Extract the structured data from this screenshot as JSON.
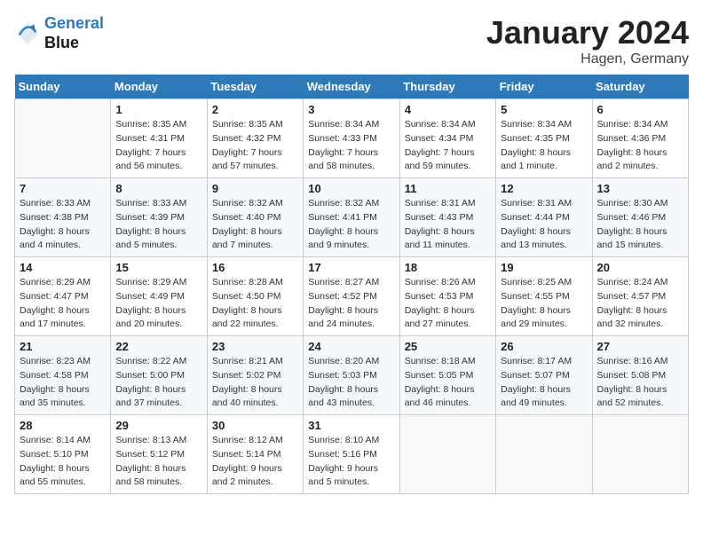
{
  "logo": {
    "line1": "General",
    "line2": "Blue"
  },
  "title": "January 2024",
  "subtitle": "Hagen, Germany",
  "days_of_week": [
    "Sunday",
    "Monday",
    "Tuesday",
    "Wednesday",
    "Thursday",
    "Friday",
    "Saturday"
  ],
  "weeks": [
    [
      {
        "day": "",
        "info": ""
      },
      {
        "day": "1",
        "info": "Sunrise: 8:35 AM\nSunset: 4:31 PM\nDaylight: 7 hours\nand 56 minutes."
      },
      {
        "day": "2",
        "info": "Sunrise: 8:35 AM\nSunset: 4:32 PM\nDaylight: 7 hours\nand 57 minutes."
      },
      {
        "day": "3",
        "info": "Sunrise: 8:34 AM\nSunset: 4:33 PM\nDaylight: 7 hours\nand 58 minutes."
      },
      {
        "day": "4",
        "info": "Sunrise: 8:34 AM\nSunset: 4:34 PM\nDaylight: 7 hours\nand 59 minutes."
      },
      {
        "day": "5",
        "info": "Sunrise: 8:34 AM\nSunset: 4:35 PM\nDaylight: 8 hours\nand 1 minute."
      },
      {
        "day": "6",
        "info": "Sunrise: 8:34 AM\nSunset: 4:36 PM\nDaylight: 8 hours\nand 2 minutes."
      }
    ],
    [
      {
        "day": "7",
        "info": "Sunrise: 8:33 AM\nSunset: 4:38 PM\nDaylight: 8 hours\nand 4 minutes."
      },
      {
        "day": "8",
        "info": "Sunrise: 8:33 AM\nSunset: 4:39 PM\nDaylight: 8 hours\nand 5 minutes."
      },
      {
        "day": "9",
        "info": "Sunrise: 8:32 AM\nSunset: 4:40 PM\nDaylight: 8 hours\nand 7 minutes."
      },
      {
        "day": "10",
        "info": "Sunrise: 8:32 AM\nSunset: 4:41 PM\nDaylight: 8 hours\nand 9 minutes."
      },
      {
        "day": "11",
        "info": "Sunrise: 8:31 AM\nSunset: 4:43 PM\nDaylight: 8 hours\nand 11 minutes."
      },
      {
        "day": "12",
        "info": "Sunrise: 8:31 AM\nSunset: 4:44 PM\nDaylight: 8 hours\nand 13 minutes."
      },
      {
        "day": "13",
        "info": "Sunrise: 8:30 AM\nSunset: 4:46 PM\nDaylight: 8 hours\nand 15 minutes."
      }
    ],
    [
      {
        "day": "14",
        "info": "Sunrise: 8:29 AM\nSunset: 4:47 PM\nDaylight: 8 hours\nand 17 minutes."
      },
      {
        "day": "15",
        "info": "Sunrise: 8:29 AM\nSunset: 4:49 PM\nDaylight: 8 hours\nand 20 minutes."
      },
      {
        "day": "16",
        "info": "Sunrise: 8:28 AM\nSunset: 4:50 PM\nDaylight: 8 hours\nand 22 minutes."
      },
      {
        "day": "17",
        "info": "Sunrise: 8:27 AM\nSunset: 4:52 PM\nDaylight: 8 hours\nand 24 minutes."
      },
      {
        "day": "18",
        "info": "Sunrise: 8:26 AM\nSunset: 4:53 PM\nDaylight: 8 hours\nand 27 minutes."
      },
      {
        "day": "19",
        "info": "Sunrise: 8:25 AM\nSunset: 4:55 PM\nDaylight: 8 hours\nand 29 minutes."
      },
      {
        "day": "20",
        "info": "Sunrise: 8:24 AM\nSunset: 4:57 PM\nDaylight: 8 hours\nand 32 minutes."
      }
    ],
    [
      {
        "day": "21",
        "info": "Sunrise: 8:23 AM\nSunset: 4:58 PM\nDaylight: 8 hours\nand 35 minutes."
      },
      {
        "day": "22",
        "info": "Sunrise: 8:22 AM\nSunset: 5:00 PM\nDaylight: 8 hours\nand 37 minutes."
      },
      {
        "day": "23",
        "info": "Sunrise: 8:21 AM\nSunset: 5:02 PM\nDaylight: 8 hours\nand 40 minutes."
      },
      {
        "day": "24",
        "info": "Sunrise: 8:20 AM\nSunset: 5:03 PM\nDaylight: 8 hours\nand 43 minutes."
      },
      {
        "day": "25",
        "info": "Sunrise: 8:18 AM\nSunset: 5:05 PM\nDaylight: 8 hours\nand 46 minutes."
      },
      {
        "day": "26",
        "info": "Sunrise: 8:17 AM\nSunset: 5:07 PM\nDaylight: 8 hours\nand 49 minutes."
      },
      {
        "day": "27",
        "info": "Sunrise: 8:16 AM\nSunset: 5:08 PM\nDaylight: 8 hours\nand 52 minutes."
      }
    ],
    [
      {
        "day": "28",
        "info": "Sunrise: 8:14 AM\nSunset: 5:10 PM\nDaylight: 8 hours\nand 55 minutes."
      },
      {
        "day": "29",
        "info": "Sunrise: 8:13 AM\nSunset: 5:12 PM\nDaylight: 8 hours\nand 58 minutes."
      },
      {
        "day": "30",
        "info": "Sunrise: 8:12 AM\nSunset: 5:14 PM\nDaylight: 9 hours\nand 2 minutes."
      },
      {
        "day": "31",
        "info": "Sunrise: 8:10 AM\nSunset: 5:16 PM\nDaylight: 9 hours\nand 5 minutes."
      },
      {
        "day": "",
        "info": ""
      },
      {
        "day": "",
        "info": ""
      },
      {
        "day": "",
        "info": ""
      }
    ]
  ]
}
